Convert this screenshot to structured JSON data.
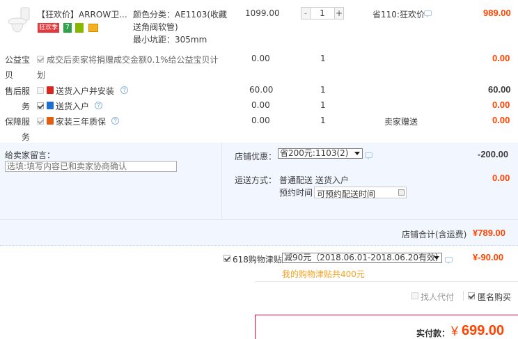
{
  "item": {
    "title": "【狂欢价】ARROW卫...",
    "tags": [
      "狂欢季"
    ],
    "sku_lines": [
      "颜色分类：AE1103(收藏",
      "送角阀软管)",
      "最小坑距：305mm"
    ],
    "unit_price": "1099.00",
    "quantity": "1",
    "discount": "省110:狂欢价",
    "subtotal": "989.00"
  },
  "services": [
    {
      "section": "公益宝",
      "section_cont": "贝",
      "text": "成交后卖家将捐赠成交金额0.1%给公益宝贝计",
      "text_cont": "划",
      "price": "0.00",
      "qty": "1",
      "note": "",
      "total": "0.00"
    },
    {
      "section": "售后服",
      "section_cont": "务",
      "text": "送货入户并安装",
      "price": "60.00",
      "qty": "1",
      "note": "",
      "total": "60.00"
    },
    {
      "section": "",
      "text": "送货入户",
      "price": "0.00",
      "qty": "1",
      "note": "",
      "total": "0.00"
    },
    {
      "section": "保障服",
      "section_cont": "务",
      "text": "家装三年质保",
      "price": "0.00",
      "qty": "1",
      "note": "卖家赠送",
      "total": "0.00"
    }
  ],
  "message": {
    "label": "给卖家留言：",
    "placeholder": "选填:填写内容已和卖家协商确认"
  },
  "shop_discount": {
    "label": "店铺优惠：",
    "selected": "省200元:1103(2)",
    "amount": "-200.00"
  },
  "shipping": {
    "label": "运送方式：",
    "method": "普通配送 送货入户",
    "time_label": "预约时间",
    "time_value": "可预约配送时间",
    "amount": "0.00"
  },
  "shop_total": {
    "label": "店铺合计(含运费)",
    "amount": "¥789.00"
  },
  "allowance": {
    "label": "618购物津贴",
    "selected": "减90元（2018.06.01-2018.06.20有效）",
    "amount": "¥-90.00",
    "note": "我的购物津贴共400元"
  },
  "options": {
    "proxy_pay": "找人代付",
    "anonymous": "匿名购买"
  },
  "payment": {
    "label": "实付款：",
    "currency": "¥",
    "amount": "699.00"
  },
  "colors": {
    "accent": "#ff4400",
    "panel": "#f2f7ff",
    "border": "#b2d1ff",
    "allowance_note": "#f2a422"
  }
}
